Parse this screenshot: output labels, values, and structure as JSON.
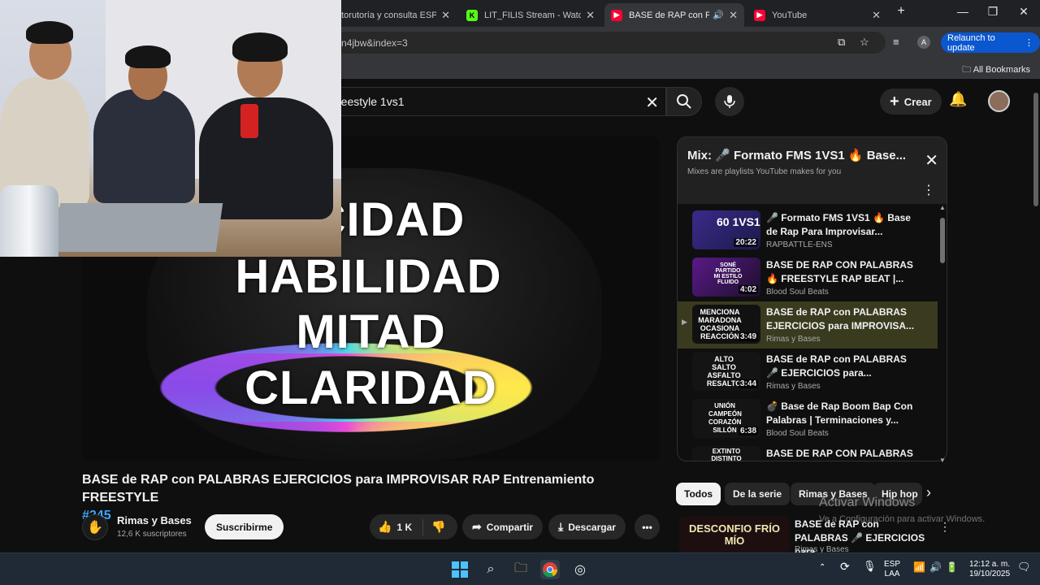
{
  "browser": {
    "tabs": [
      {
        "title": "torutoría y consulta ESPINOZ",
        "favicon": "page-icon"
      },
      {
        "title": "LIT_FILIS Stream - Watch Li",
        "favicon": "kick-icon"
      },
      {
        "title": "BASE de RAP con PALA",
        "favicon": "youtube-icon",
        "active": true
      },
      {
        "title": "YouTube",
        "favicon": "youtube-icon"
      }
    ],
    "new_tab": "+",
    "url": "n4jbw&index=3",
    "relaunch": "Relaunch to update",
    "profile_initial": "A",
    "bookmarks": "All Bookmarks"
  },
  "youtube": {
    "search_query": "reestyle 1vs1",
    "create": "Crear"
  },
  "video": {
    "overlay_words": [
      "ACIDAD",
      "HABILIDAD",
      "MITAD",
      "CLARIDAD"
    ],
    "title": "BASE de RAP con PALABRAS EJERCICIOS para IMPROVISAR RAP Entrenamiento FREESTYLE",
    "hashtag": "#245",
    "channel": "Rimas y Bases",
    "subscribers": "12,6 K suscriptores",
    "subscribe": "Suscribirme",
    "likes": "1 K",
    "share": "Compartir",
    "download": "Descargar"
  },
  "mix": {
    "title": "Mix: 🎤 Formato FMS 1VS1 🔥 Base...",
    "subtitle": "Mixes are playlists YouTube makes for you",
    "items": [
      {
        "title": "🎤 Formato FMS 1VS1 🔥 Base de Rap Para Improvisar...",
        "channel": "RAPBATTLE-ENS",
        "duration": "20:22",
        "thumb": "60 1VS1"
      },
      {
        "title": "BASE DE RAP CON PALABRAS 🔥 FREESTYLE RAP BEAT |...",
        "channel": "Blood Soul Beats",
        "duration": "4:02",
        "thumb": "SONÉ PARTIDO MI ESTILO FLUIDO"
      },
      {
        "title": "BASE de RAP con PALABRAS EJERCICIOS para IMPROVISA...",
        "channel": "Rimas y Bases",
        "duration": "3:49",
        "thumb": "MENCIONA MARADONA OCASIONA REACCIÓN",
        "current": true
      },
      {
        "title": "BASE de RAP con PALABRAS 🎤 EJERCICIOS para...",
        "channel": "Rimas y Bases",
        "duration": "3:44",
        "thumb": "ALTO SALTO ASFALTO RESALTO"
      },
      {
        "title": "💣 Base de Rap Boom Bap Con Palabras | Terminaciones y...",
        "channel": "Blood Soul Beats",
        "duration": "6:38",
        "thumb": "UNIÓN CAMPEÓN CORAZÓN SILLÓN"
      },
      {
        "title": "BASE DE RAP CON PALABRAS",
        "channel": "",
        "duration": "",
        "thumb": "EXTINTO DISTINTO"
      }
    ]
  },
  "chips": [
    "Todos",
    "De la serie",
    "Rimas y Bases",
    "Hip hop"
  ],
  "recommendation": {
    "thumb": "DESCONFIO FRÍO MÍO",
    "title": "BASE de RAP con PALABRAS 🎤 EJERCICIOS para ...",
    "channel": "Rimas y Bases"
  },
  "windows_watermark": {
    "line1": "Activar Windows",
    "line2": "Ve a Configuración para activar Windows."
  },
  "taskbar": {
    "lang": [
      "ESP",
      "LAA"
    ],
    "time": "12:12 a. m.",
    "date": "19/10/2025"
  }
}
